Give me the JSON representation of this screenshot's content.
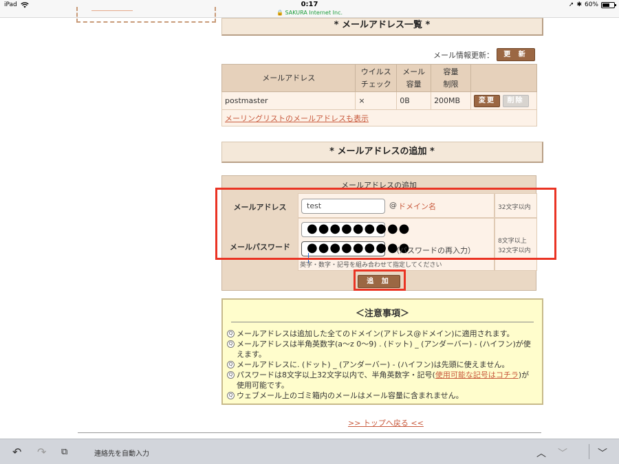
{
  "status_bar": {
    "device": "iPad",
    "time": "0:17",
    "url": "SAKURA Internet Inc.",
    "battery": "60%",
    "battery_level": 0.6
  },
  "mail_list": {
    "header": "* メールアドレス一覧 *",
    "update_label": "メール情報更新：",
    "update_button": "更 新",
    "columns": [
      "メールアドレス",
      "ウイルスチェック",
      "メール容量",
      "容量制限"
    ],
    "columns_display": {
      "address": "メールアドレス",
      "virus_1": "ウイルス",
      "virus_2": "チェック",
      "size_1": "メール",
      "size_2": "容量",
      "limit_1": "容量",
      "limit_2": "制限"
    },
    "rows": [
      {
        "address": "postmaster",
        "virus_check": "×",
        "size": "0B",
        "limit": "200MB",
        "edit_button": "変更",
        "delete_button": "削除"
      }
    ],
    "show_lists_link": "メーリングリストのメールアドレスも表示"
  },
  "add_section": {
    "header": "* メールアドレスの追加 *",
    "form_caption": "メールアドレスの追加",
    "address_label": "メールアドレス",
    "address_value": "test",
    "at_sign": "@",
    "domain_link": "ドメイン名",
    "address_limit": "32文字以内",
    "password_label": "メールパスワード",
    "password_value": "●●●●●●●●●",
    "password_confirm_value": "●●●●●●●●●",
    "password_confirm_hint": "（パスワードの再入力）",
    "password_limit_1": "8文字以上",
    "password_limit_2": "32文字以内",
    "password_hint": "英字・数字・記号を組み合わせて指定してください",
    "add_button": "追 加"
  },
  "notice": {
    "title": "＜注意事項＞",
    "items": [
      "メールアドレスは追加した全てのドメイン(アドレス@ドメイン)に適用されます。",
      "メールアドレスは半角英数字(a〜z 0〜9) . (ドット) _ (アンダーバー) - (ハイフン)が使えます。",
      "メールアドレスに. (ドット) _ (アンダーバー) - (ハイフン)は先頭に使えません。",
      "ウェブメール上のゴミ箱内のメールはメール容量に含まれません。"
    ],
    "password_item_before": "パスワードは8文字以上32文字以内で、半角英数字・記号(",
    "password_item_link": "使用可能な記号はコチラ",
    "password_item_after": ")が使用可能です。"
  },
  "footer": {
    "top_link": ">> トップへ戻る <<"
  },
  "keyboard_bar": {
    "autofill_label": "連絡先を自動入力"
  }
}
